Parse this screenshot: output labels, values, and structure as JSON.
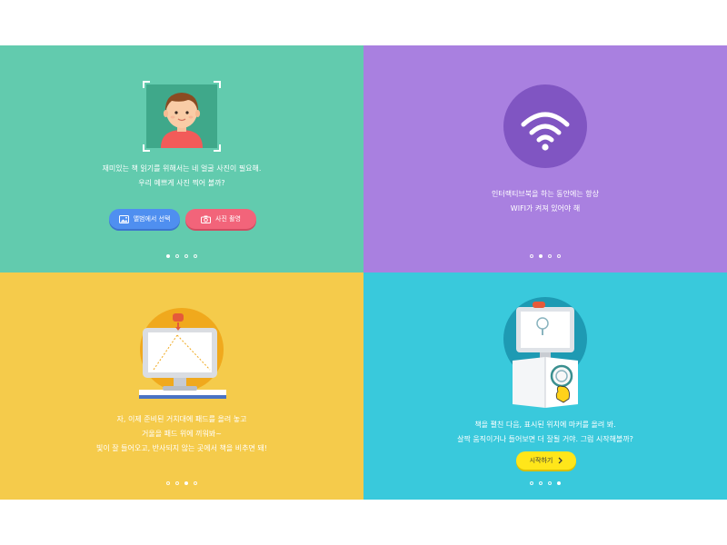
{
  "panels": [
    {
      "lines": [
        "재미있는 책 읽기를 위해서는 네 얼굴 사진이 필요해.",
        "우리 예쁘게 사진 찍어 볼까?"
      ],
      "buttons": {
        "album": "앨범에서 선택",
        "camera": "사진 촬영"
      },
      "page_indicator": {
        "total": 4,
        "current": 1
      }
    },
    {
      "lines": [
        "인터랙티브북을 하는 동안에는 항상",
        "WIFI가 켜져 있어야 해"
      ],
      "page_indicator": {
        "total": 4,
        "current": 2
      }
    },
    {
      "lines": [
        "자, 이제 준비된 거치대에 패드를 올려 놓고",
        "거울을 패드 위에 끼워봐~",
        "빛이 잘 들어오고, 반사되지 않는 곳에서 책을 비추면 돼!"
      ],
      "page_indicator": {
        "total": 4,
        "current": 3
      }
    },
    {
      "lines": [
        "책을 펼친 다음, 표시된 위치에 마커를 올려 봐.",
        "살짝 움직이거나 들어보면 더 잘될 거야. 그럼 시작해볼까?"
      ],
      "start_label": "시작하기",
      "page_indicator": {
        "total": 4,
        "current": 4
      }
    }
  ],
  "colors": {
    "panel1_bg": "#62cbae",
    "panel2_bg": "#a980e0",
    "panel3_bg": "#f5cb4b",
    "panel4_bg": "#39c9dc",
    "album_button": "#4f8ff0",
    "camera_button": "#f2647a",
    "start_button": "#ffe61a"
  },
  "icons": [
    "avatar-illustration",
    "image-icon",
    "camera-icon",
    "wifi-icon",
    "tablet-stand-illustration",
    "tablet-book-marker-illustration",
    "chevron-right-icon"
  ]
}
